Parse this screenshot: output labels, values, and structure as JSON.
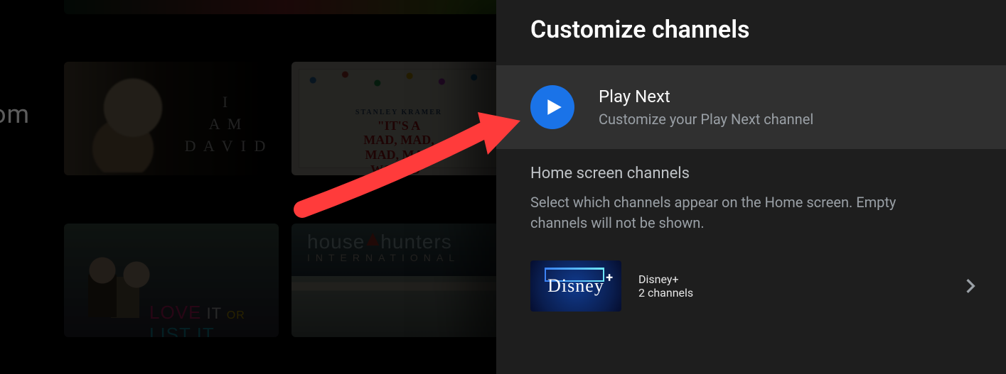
{
  "bg": {
    "left_fragment": "om",
    "tile_a_line1": "I",
    "tile_a_line2": "A M",
    "tile_a_line3": "D A V I D",
    "tile_b_small": "STANLEY KRAMER",
    "tile_b_l1": "\"IT'S A",
    "tile_b_l2": "MAD, MAD,",
    "tile_b_l3": "MAD, MAD",
    "tile_b_l4": "WORLD\"",
    "love": "LOVE",
    "it": " IT ",
    "or": "OR",
    "list": " LIST IT",
    "hh_word1": "house",
    "hh_word2": "hunters",
    "hh_sub": "INTERNATIONAL"
  },
  "panel": {
    "title": "Customize channels",
    "play_next": {
      "title": "Play Next",
      "subtitle": "Customize your Play Next channel"
    },
    "home_section": {
      "title": "Home screen channels",
      "description": "Select which channels appear on the Home screen. Empty channels will not be shown."
    },
    "channels": [
      {
        "app_name": "Disney+",
        "thumb_text": "Disney",
        "count_label": "2 channels"
      }
    ]
  }
}
